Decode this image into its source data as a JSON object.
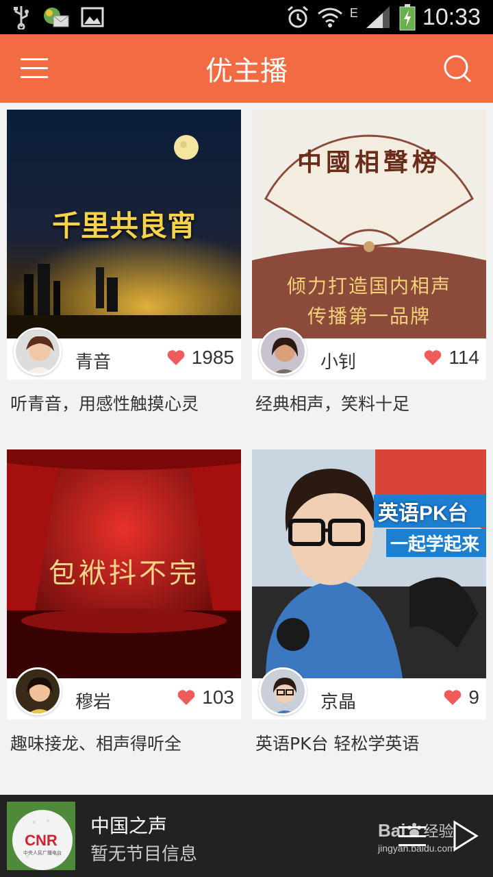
{
  "status_bar": {
    "time": "10:33",
    "network": "E",
    "icons": [
      "usb-icon",
      "message-notification-icon",
      "image-notification-icon",
      "alarm-icon",
      "wifi-icon",
      "signal-icon",
      "battery-charging-icon"
    ]
  },
  "app_bar": {
    "title": "优主播",
    "menu_icon": "hamburger-menu-icon",
    "search_icon": "search-icon",
    "background": "#f36b43"
  },
  "cards": [
    {
      "cover_text": "千里共良宵",
      "host": "青音",
      "likes": "1985",
      "description": "听青音，用感性触摸心灵"
    },
    {
      "cover_text_1": "倾力打造国内相声",
      "cover_text_2": "传播第一品牌",
      "fan_text": "中國相聲榜",
      "host": "小钊",
      "likes": "114",
      "description": "经典相声，笑料十足"
    },
    {
      "cover_text": "包袱抖不完",
      "host": "穆岩",
      "likes": "103",
      "description": "趣味接龙、相声得听全"
    },
    {
      "cover_text_1": "英语PK台",
      "cover_text_2": "一起学起来",
      "host": "京晶",
      "likes": "9",
      "description": "英语PK台 轻松学英语"
    }
  ],
  "player": {
    "station": "中国之声",
    "program": "暂无节目信息",
    "thumb_logo": "CNR",
    "thumb_caption": "中央人民广播电台",
    "playlist_icon": "playlist-icon",
    "play_icon": "play-icon"
  },
  "watermark": {
    "brand": "Bai",
    "brand_suffix": "经验",
    "url": "jingyan.baidu.com"
  },
  "colors": {
    "accent": "#f36b43",
    "heart": "#ef5a5a",
    "player_bg": "#222222"
  }
}
